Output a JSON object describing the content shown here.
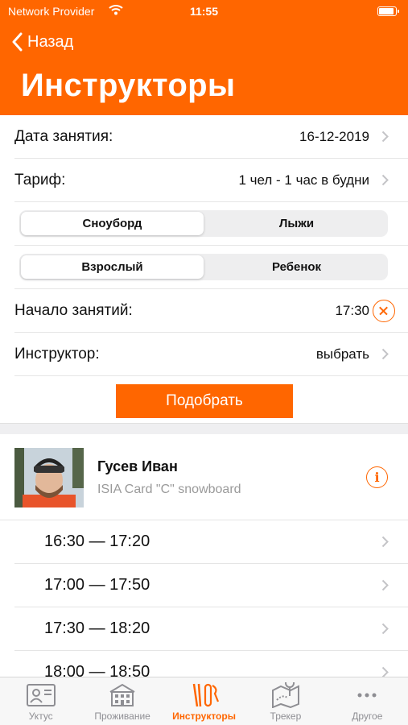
{
  "status_bar": {
    "provider": "Network Provider",
    "time": "11:55"
  },
  "nav": {
    "back_label": "Назад",
    "title": "Инструкторы"
  },
  "form": {
    "date": {
      "label": "Дата занятия:",
      "value": "16-12-2019"
    },
    "tariff": {
      "label": "Тариф:",
      "value": "1 чел - 1 час в будни"
    },
    "sport_segment": {
      "options": [
        "Сноуборд",
        "Лыжи"
      ],
      "selected": "Сноуборд"
    },
    "age_segment": {
      "options": [
        "Взрослый",
        "Ребенок"
      ],
      "selected": "Взрослый"
    },
    "start_time": {
      "label": "Начало занятий:",
      "value": "17:30"
    },
    "instructor": {
      "label": "Инструктор:",
      "value": "выбрать"
    },
    "submit_label": "Подобрать"
  },
  "instructor": {
    "name": "Гусев Иван",
    "certificate": "ISIA Card \"C\" snowboard"
  },
  "slots": [
    "16:30 — 17:20",
    "17:00 — 17:50",
    "17:30 — 18:20",
    "18:00 — 18:50"
  ],
  "tabbar": {
    "items": [
      {
        "label": "Уктус",
        "icon": "id-card-icon"
      },
      {
        "label": "Проживание",
        "icon": "hotel-icon"
      },
      {
        "label": "Инструкторы",
        "icon": "ski-snowboard-icon"
      },
      {
        "label": "Трекер",
        "icon": "map-tracker-icon"
      },
      {
        "label": "Другое",
        "icon": "more-dots-icon"
      }
    ],
    "active": "Инструкторы"
  },
  "colors": {
    "accent": "#ff6600",
    "separator": "#efeff1",
    "secondary_text": "#9a9a9a"
  }
}
